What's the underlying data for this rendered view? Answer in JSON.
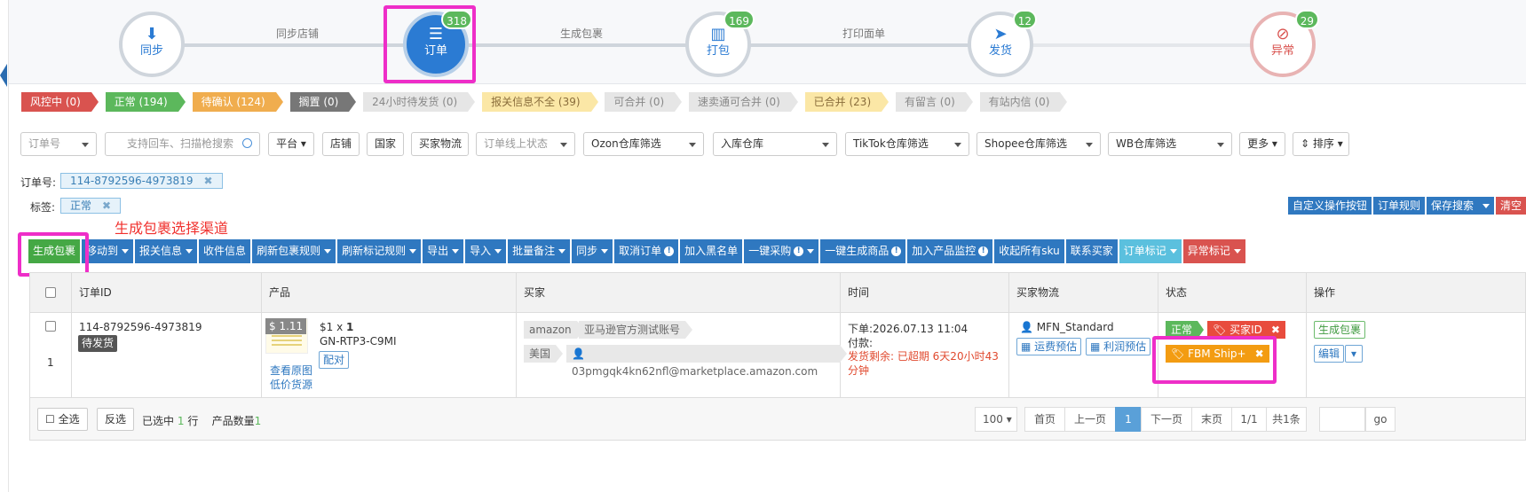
{
  "stepper": {
    "steps": [
      {
        "label": "同步",
        "badge": ""
      },
      {
        "label": "订单",
        "badge": "318"
      },
      {
        "label": "打包",
        "badge": "169"
      },
      {
        "label": "发货",
        "badge": "12"
      },
      {
        "label": "异常",
        "badge": "29"
      }
    ],
    "connectors": [
      "同步店铺",
      "生成包裹",
      "打印面单"
    ]
  },
  "status_tags": [
    {
      "label": "风控中 (0)",
      "color": "#d9534f"
    },
    {
      "label": "正常 (194)",
      "color": "#5cb85c"
    },
    {
      "label": "待确认 (124)",
      "color": "#f0ad4e"
    },
    {
      "label": "搁置 (0)",
      "color": "#777777"
    },
    {
      "label": "24小时待发货 (0)",
      "color": "#e6e6e6"
    },
    {
      "label": "报关信息不全 (39)",
      "color": "#fbe7a6"
    },
    {
      "label": "可合并 (0)",
      "color": "#e6e6e6"
    },
    {
      "label": "速卖通可合并 (0)",
      "color": "#e6e6e6"
    },
    {
      "label": "已合并 (23)",
      "color": "#fbe7a6"
    },
    {
      "label": "有留言 (0)",
      "color": "#e6e6e6"
    },
    {
      "label": "有站内信 (0)",
      "color": "#e6e6e6"
    }
  ],
  "filters": {
    "order_no": "订单号",
    "search_placeholder": "支持回车、扫描枪搜索",
    "platform": "平台",
    "shop": "店铺",
    "country": "国家",
    "buyer_logistics": "买家物流",
    "online_status": "订单线上状态",
    "ozon": "Ozon仓库筛选",
    "inbound": "入库仓库",
    "tiktok": "TikTok仓库筛选",
    "shopee": "Shopee仓库筛选",
    "wb": "WB仓库筛选",
    "more": "更多",
    "sort": "排序"
  },
  "conditions": {
    "order_label": "订单号:",
    "order_value": "114-8792596-4973819",
    "tag_label": "标签:",
    "tag_value": "正常"
  },
  "right_buttons": {
    "custom": "自定义操作按钮",
    "rules": "订单规则",
    "save": "保存搜索",
    "clear": "清空"
  },
  "annotation": "生成包裹选择渠道",
  "toolbar": [
    {
      "label": "生成包裹",
      "style": "green",
      "caret": false,
      "info": false
    },
    {
      "label": "移动到",
      "style": "blue",
      "caret": true,
      "info": false
    },
    {
      "label": "报关信息",
      "style": "blue",
      "caret": true,
      "info": false
    },
    {
      "label": "收件信息",
      "style": "blue",
      "caret": false,
      "info": false
    },
    {
      "label": "刷新包裹规则",
      "style": "blue",
      "caret": true,
      "info": false
    },
    {
      "label": "刷新标记规则",
      "style": "blue",
      "caret": true,
      "info": false
    },
    {
      "label": "导出",
      "style": "blue",
      "caret": true,
      "info": false
    },
    {
      "label": "导入",
      "style": "blue",
      "caret": true,
      "info": false
    },
    {
      "label": "批量备注",
      "style": "blue",
      "caret": true,
      "info": false
    },
    {
      "label": "同步",
      "style": "blue",
      "caret": true,
      "info": false
    },
    {
      "label": "取消订单",
      "style": "blue",
      "caret": false,
      "info": true
    },
    {
      "label": "加入黑名单",
      "style": "blue",
      "caret": false,
      "info": false
    },
    {
      "label": "一键采购",
      "style": "blue",
      "caret": true,
      "info": true
    },
    {
      "label": "一键生成商品",
      "style": "blue",
      "caret": false,
      "info": true
    },
    {
      "label": "加入产品监控",
      "style": "blue",
      "caret": false,
      "info": true
    },
    {
      "label": "收起所有sku",
      "style": "blue",
      "caret": false,
      "info": false
    },
    {
      "label": "联系买家",
      "style": "blue",
      "caret": false,
      "info": false
    },
    {
      "label": "订单标记",
      "style": "cyan",
      "caret": true,
      "info": false
    },
    {
      "label": "异常标记",
      "style": "red",
      "caret": true,
      "info": false
    }
  ],
  "table": {
    "headers": [
      "订单ID",
      "产品",
      "买家",
      "时间",
      "买家物流",
      "状态",
      "操作"
    ],
    "row": {
      "order_id": "114-8792596-4973819",
      "order_status": "待发货",
      "index": "1",
      "price": "$ 1.11",
      "qty_prefix": "$1 x ",
      "qty": "1",
      "sku": "GN-RTP3-C9MI",
      "view_image": "查看原图",
      "low_price": "低价货源",
      "match": "配对",
      "platform": "amazon",
      "account": "亚马逊官方测试账号",
      "country": "美国",
      "email": "03pmgqk4kn62nfl@marketplace.amazon.com",
      "order_time": "下单:2026.07.13 11:04",
      "paid": "付款:",
      "remaining": "发货剩余: 已超期 6天20小时43分钟",
      "logistics": "MFN_Standard",
      "freight": "运费预估",
      "profit": "利润预估",
      "status_normal": "正常",
      "tag_buyer": "买家ID",
      "tag_fbm": "FBM Ship+",
      "op_generate": "生成包裹",
      "op_edit": "编辑"
    }
  },
  "footer": {
    "select_all": "全选",
    "invert": "反选",
    "selected_prefix": "已选中",
    "selected_count": "1",
    "selected_suffix": "行",
    "product_label": "产品数量",
    "product_count": "1",
    "page_size": "100",
    "first": "首页",
    "prev": "上一页",
    "current": "1",
    "next": "下一页",
    "last": "末页",
    "ratio": "1/1",
    "total": "共1条",
    "go": "go"
  },
  "colors": {
    "accent": "#2f78c0",
    "highlight": "#ee2ec8",
    "annotation": "#f0312e"
  },
  "icons": [
    "download-icon",
    "list-icon",
    "barcode-icon",
    "paper-plane-icon",
    "eye-slash-icon",
    "search-icon",
    "user-icon",
    "calculator-icon",
    "tag-icon",
    "close-icon",
    "info-icon",
    "caret-down-icon",
    "sort-icon"
  ]
}
